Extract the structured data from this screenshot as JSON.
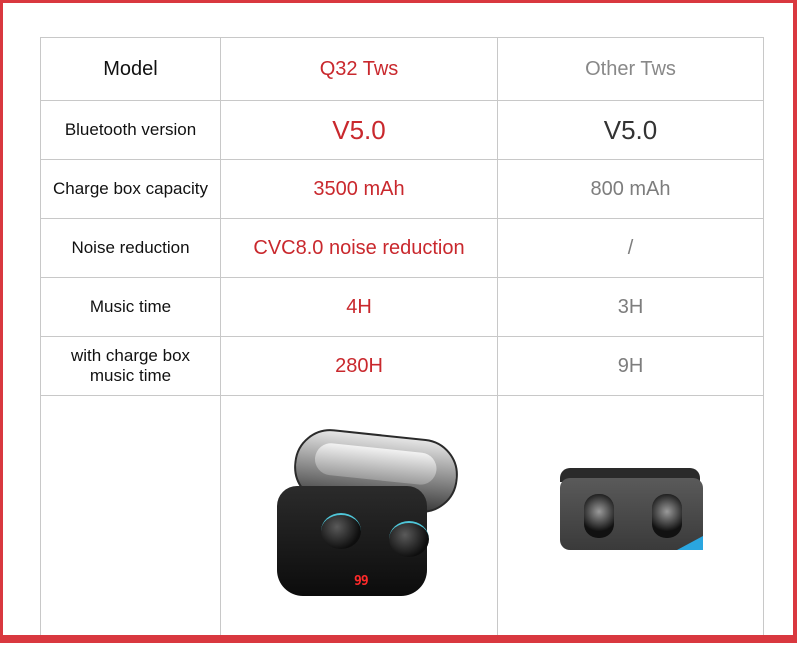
{
  "table": {
    "header": {
      "label": "Model",
      "q32": "Q32 Tws",
      "other": "Other Tws"
    },
    "rows": [
      {
        "label": "Bluetooth version",
        "q32": "V5.0",
        "other": "V5.0"
      },
      {
        "label": "Charge box capacity",
        "q32": "3500 mAh",
        "other": "800 mAh"
      },
      {
        "label": "Noise reduction",
        "q32": "CVC8.0 noise reduction",
        "other": "/"
      },
      {
        "label": "Music time",
        "q32": "4H",
        "other": "3H"
      },
      {
        "label": "with charge box music time",
        "q32": "280H",
        "other": "9H"
      }
    ],
    "images": {
      "q32_display": "99",
      "q32_alt": "Q32 TWS earbuds in black charging case with LED display",
      "other_alt": "Other TWS earbuds charging case (open, empty)"
    }
  },
  "colors": {
    "frame": "#d9383f",
    "q32_text": "#c9282d",
    "other_text": "#7d7d7d",
    "grid": "#c8c8c8"
  }
}
